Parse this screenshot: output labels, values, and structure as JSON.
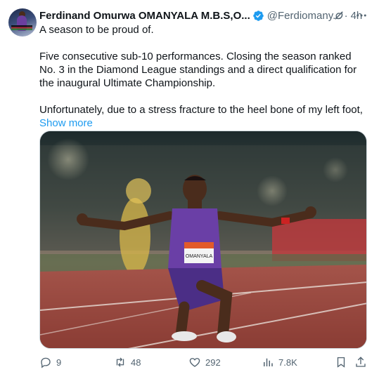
{
  "author": {
    "name": "Ferdinand Omurwa OMANYALA M.B.S,O...",
    "handle": "@Ferdiomany...",
    "separator": "·",
    "time": "4h"
  },
  "tweet": {
    "line1": "A season to be proud of.",
    "line2": "Five consecutive sub-10 performances. Closing the season ranked No. 3 in the Diamond League standings and a direct qualification for the inaugural Ultimate Championship.",
    "line3": "Unfortunately, due to a stress fracture to the heel bone of my left foot,",
    "show_more": "Show more"
  },
  "media": {
    "bib_name": "OMANYALA",
    "icon": "photo-sprinter-kneeling-on-track"
  },
  "actions": {
    "replies": "9",
    "reposts": "48",
    "likes": "292",
    "views": "7.8K"
  },
  "icons": {
    "verified": "verified-badge-icon",
    "grok": "grok-icon",
    "more": "more-icon",
    "reply": "reply-icon",
    "repost": "repost-icon",
    "like": "heart-icon",
    "views": "views-icon",
    "bookmark": "bookmark-icon",
    "share": "share-icon"
  },
  "colors": {
    "text": "#0f1419",
    "secondary": "#536471",
    "accent": "#1d9bf0"
  }
}
